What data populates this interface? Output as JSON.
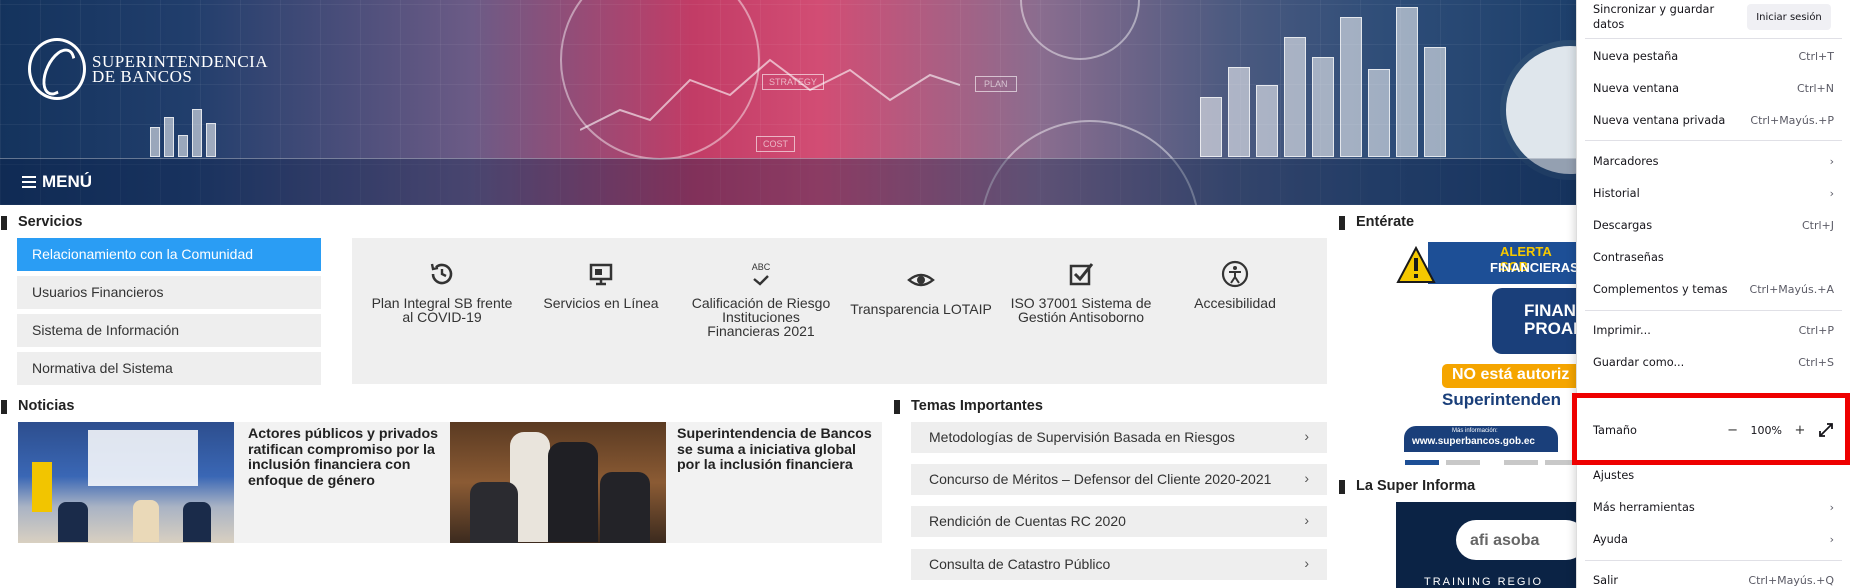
{
  "header": {
    "logo_line1": "Superintendencia",
    "logo_line2": "de Bancos",
    "menu_label": "MENÚ",
    "chart_words": [
      "STRATEGY",
      "PLAN",
      "COST"
    ]
  },
  "servicios": {
    "title": "Servicios",
    "items": [
      {
        "label": "Relacionamiento con la Comunidad",
        "active": true
      },
      {
        "label": "Usuarios Financieros",
        "active": false
      },
      {
        "label": "Sistema de Información",
        "active": false
      },
      {
        "label": "Normativa del Sistema",
        "active": false
      }
    ],
    "tiles": [
      {
        "icon": "history-icon",
        "label": "Plan Integral SB frente al COVID-19"
      },
      {
        "icon": "monitor-icon",
        "label": "Servicios en Línea"
      },
      {
        "icon": "abc-check-icon",
        "abc": "ABC",
        "label": "Calificación de Riesgo Instituciones Financieras 2021"
      },
      {
        "icon": "eye-icon",
        "label": "Transparencia LOTAIP"
      },
      {
        "icon": "checkbox-icon",
        "label": "ISO 37001 Sistema de Gestión Antisoborno"
      },
      {
        "icon": "accessibility-icon",
        "label": "Accesibilidad"
      }
    ]
  },
  "noticias": {
    "title": "Noticias",
    "items": [
      {
        "text": "Actores públicos y privados ratifican compromiso por la inclusión financiera con enfoque de género"
      },
      {
        "text": "Superintendencia de Bancos se suma a iniciativa global por la inclusión financiera"
      }
    ]
  },
  "temas": {
    "title": "Temas Importantes",
    "items": [
      "Metodologías de Supervisión Basada en Riesgos",
      "Concurso de Méritos – Defensor del Cliente 2020-2021",
      "Rendición de Cuentas RC 2020",
      "Consulta de Catastro Público"
    ]
  },
  "enterate": {
    "title": "Entérate",
    "alert_line1": "ALERTA SOB",
    "alert_line2": "FINANCIERAS",
    "box_line1": "FINANC",
    "box_line2": "PROAM",
    "warning": "NO está autoriz",
    "brand": "Superintenden",
    "info": "Más información:",
    "url": "www.superbancos.gob.ec"
  },
  "super_informa": {
    "title": "La Super Informa",
    "logos": "afi  asoba",
    "banner_text": "TRAINING REGIO"
  },
  "firefox_menu": {
    "sync_label": "Sincronizar y guardar datos",
    "sync_button": "Iniciar sesión",
    "items": [
      {
        "label": "Nueva pestaña",
        "shortcut": "Ctrl+T"
      },
      {
        "label": "Nueva ventana",
        "shortcut": "Ctrl+N"
      },
      {
        "label": "Nueva ventana privada",
        "shortcut": "Ctrl+Mayús.+P"
      },
      {
        "label": "Marcadores",
        "shortcut": ""
      },
      {
        "label": "Historial",
        "shortcut": ""
      },
      {
        "label": "Descargas",
        "shortcut": "Ctrl+J"
      },
      {
        "label": "Contraseñas",
        "shortcut": ""
      },
      {
        "label": "Complementos y temas",
        "shortcut": "Ctrl+Mayús.+A"
      },
      {
        "label": "Imprimir...",
        "shortcut": "Ctrl+P"
      },
      {
        "label": "Guardar como...",
        "shortcut": "Ctrl+S"
      },
      {
        "label": "Ajustes",
        "shortcut": ""
      },
      {
        "label": "Más herramientas",
        "shortcut": ""
      },
      {
        "label": "Ayuda",
        "shortcut": ""
      },
      {
        "label": "Salir",
        "shortcut": "Ctrl+Mayús.+Q"
      }
    ],
    "zoom": {
      "label": "Tamaño",
      "minus": "−",
      "value": "100%",
      "plus": "+"
    }
  },
  "colors": {
    "accent_blue": "#2a9df4",
    "highlight_red": "#ee0000",
    "navy": "#14335d"
  }
}
